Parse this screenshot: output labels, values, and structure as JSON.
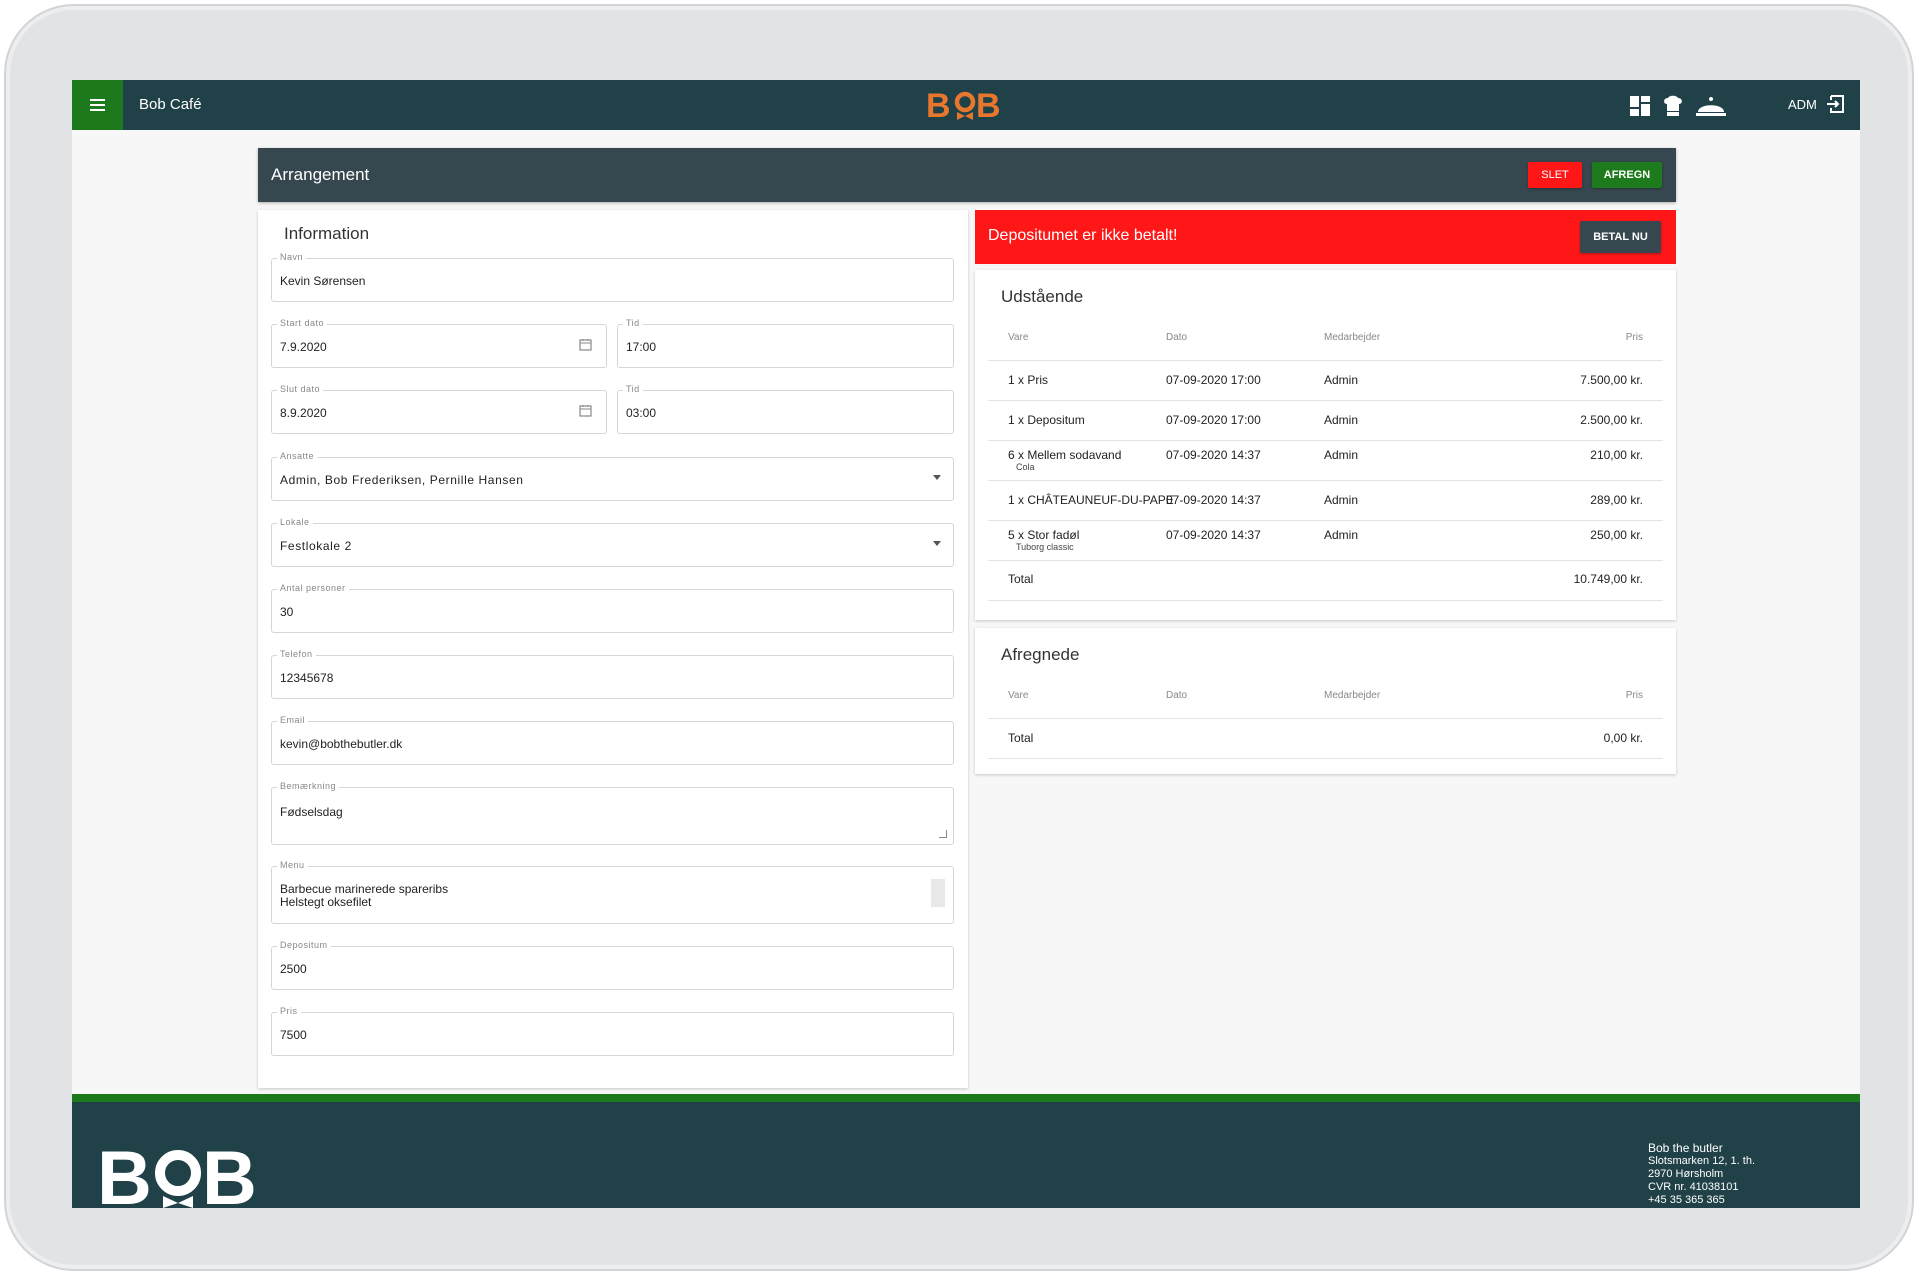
{
  "app": {
    "title": "Bob Café",
    "logo_text": "BOB",
    "user": "ADM",
    "nav_icons": [
      "dashboard-icon",
      "chef-hat-icon",
      "serving-dish-icon"
    ]
  },
  "page": {
    "title": "Arrangement",
    "delete_label": "SLET",
    "settle_label": "AFREGN"
  },
  "info": {
    "title": "Information",
    "fields": {
      "name": {
        "label": "Navn",
        "value": "Kevin Sørensen"
      },
      "start_date": {
        "label": "Start dato",
        "value": "7.9.2020"
      },
      "start_time": {
        "label": "Tid",
        "value": "17:00"
      },
      "end_date": {
        "label": "Slut dato",
        "value": "8.9.2020"
      },
      "end_time": {
        "label": "Tid",
        "value": "03:00"
      },
      "employees": {
        "label": "Ansatte",
        "value": "Admin, Bob Frederiksen, Pernille Hansen"
      },
      "venue": {
        "label": "Lokale",
        "value": "Festlokale 2"
      },
      "guests": {
        "label": "Antal personer",
        "value": "30"
      },
      "phone": {
        "label": "Telefon",
        "value": "12345678"
      },
      "email": {
        "label": "Email",
        "value": "kevin@bobthebutler.dk"
      },
      "note": {
        "label": "Bemærkning",
        "value": "Fødselsdag"
      },
      "menu": {
        "label": "Menu",
        "value": "Barbecue marinerede spareribs\nHelstegt oksefilet"
      },
      "deposit": {
        "label": "Depositum",
        "value": "2500"
      },
      "price": {
        "label": "Pris",
        "value": "7500"
      }
    }
  },
  "alert": {
    "text": "Depositumet er ikke betalt!",
    "pay_label": "BETAL NU"
  },
  "outstanding": {
    "title": "Udstående",
    "headers": {
      "item": "Vare",
      "date": "Dato",
      "employee": "Medarbejder",
      "price": "Pris"
    },
    "rows": [
      {
        "item": "1 x Pris",
        "sub": "",
        "date": "07-09-2020 17:00",
        "employee": "Admin",
        "price": "7.500,00 kr."
      },
      {
        "item": "1 x Depositum",
        "sub": "",
        "date": "07-09-2020 17:00",
        "employee": "Admin",
        "price": "2.500,00 kr."
      },
      {
        "item": "6 x Mellem sodavand",
        "sub": "Cola",
        "date": "07-09-2020 14:37",
        "employee": "Admin",
        "price": "210,00 kr."
      },
      {
        "item": "1 x CHÂTEAUNEUF-DU-PAPE",
        "sub": "",
        "date": "07-09-2020 14:37",
        "employee": "Admin",
        "price": "289,00 kr."
      },
      {
        "item": "5 x Stor fadøl",
        "sub": "Tuborg classic",
        "date": "07-09-2020 14:37",
        "employee": "Admin",
        "price": "250,00 kr."
      }
    ],
    "total_label": "Total",
    "total_value": "10.749,00 kr."
  },
  "settled": {
    "title": "Afregnede",
    "headers": {
      "item": "Vare",
      "date": "Dato",
      "employee": "Medarbejder",
      "price": "Pris"
    },
    "total_label": "Total",
    "total_value": "0,00 kr."
  },
  "footer": {
    "logo_text": "BOB",
    "company": "Bob the butler",
    "address1": "Slotsmarken 12, 1. th.",
    "address2": "2970 Hørsholm",
    "cvr": "CVR nr. 41038101",
    "phone": "+45 35 365 365"
  },
  "colors": {
    "header": "#1f4147",
    "accent_green": "#1c7a1c",
    "danger": "#ff1717",
    "logo_orange": "#e8772e",
    "dark_slate": "#36474f"
  }
}
